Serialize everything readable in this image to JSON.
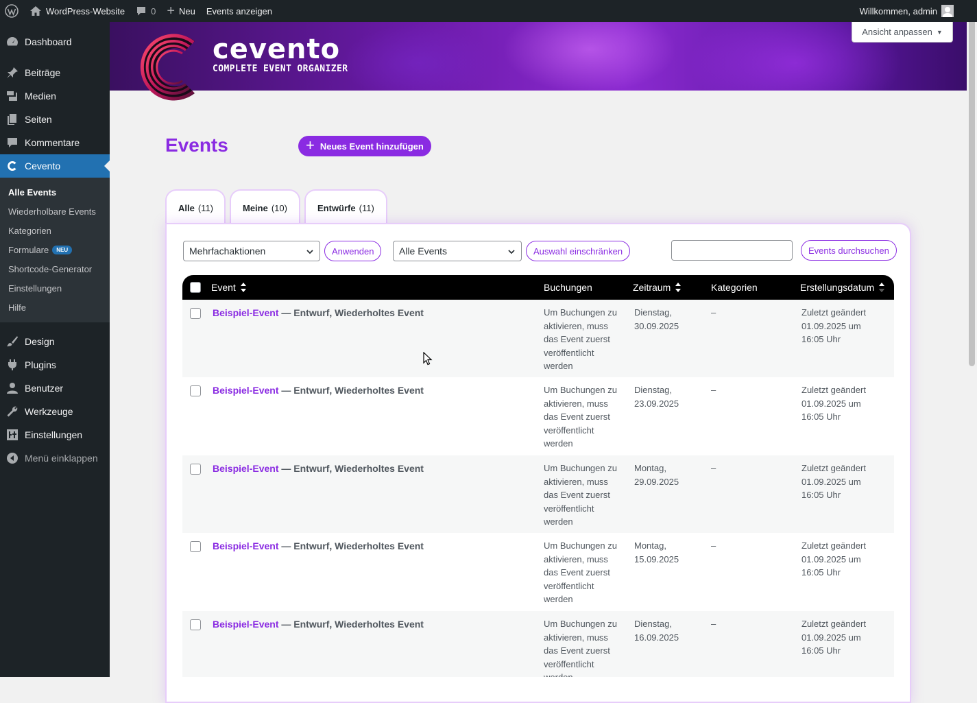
{
  "adminbar": {
    "site_name": "WordPress-Website",
    "comments_count": "0",
    "new_label": "Neu",
    "view_events": "Events anzeigen",
    "welcome": "Willkommen, admin"
  },
  "screen_options": "Ansicht anpassen",
  "brand": {
    "name": "cevento",
    "tagline": "COMPLETE EVENT ORGANIZER"
  },
  "sidebar": {
    "items": [
      {
        "label": "Dashboard",
        "icon": "dashboard-icon"
      },
      {
        "label": "Beiträge",
        "icon": "pin-icon"
      },
      {
        "label": "Medien",
        "icon": "media-icon"
      },
      {
        "label": "Seiten",
        "icon": "pages-icon"
      },
      {
        "label": "Kommentare",
        "icon": "comment-icon"
      },
      {
        "label": "Cevento",
        "icon": "cevento-icon"
      }
    ],
    "submenu": [
      {
        "label": "Alle Events"
      },
      {
        "label": "Wiederholbare Events"
      },
      {
        "label": "Kategorien"
      },
      {
        "label": "Formulare",
        "badge": "NEU"
      },
      {
        "label": "Shortcode-Generator"
      },
      {
        "label": "Einstellungen"
      },
      {
        "label": "Hilfe"
      }
    ],
    "items2": [
      {
        "label": "Design",
        "icon": "brush-icon"
      },
      {
        "label": "Plugins",
        "icon": "plugin-icon"
      },
      {
        "label": "Benutzer",
        "icon": "user-icon"
      },
      {
        "label": "Werkzeuge",
        "icon": "wrench-icon"
      },
      {
        "label": "Einstellungen",
        "icon": "settings-icon"
      },
      {
        "label": "Menü einklappen",
        "icon": "collapse-icon"
      }
    ]
  },
  "main": {
    "title": "Events",
    "add_new": "Neues Event hinzufügen",
    "tabs": [
      {
        "label": "Alle",
        "count": "(11)"
      },
      {
        "label": "Meine",
        "count": "(10)"
      },
      {
        "label": "Entwürfe",
        "count": "(11)"
      }
    ],
    "bulk_select": "Mehrfachaktionen",
    "apply": "Anwenden",
    "filter_select": "Alle Events",
    "filter_button": "Auswahl einschränken",
    "search_value": "",
    "search_button": "Events durchsuchen"
  },
  "table": {
    "columns": [
      "Event",
      "Buchungen",
      "Zeitraum",
      "Kategorien",
      "Erstellungsdatum"
    ],
    "rows": [
      {
        "title": "Beispiel-Event",
        "state": " — Entwurf, Wiederholtes Event",
        "bookings": "Um Buchungen zu aktivieren, muss das Event zuerst veröffentlicht werden",
        "day": "Dienstag,",
        "date": "30.09.2025",
        "category": "–",
        "created_1": "Zuletzt geändert",
        "created_2": "01.09.2025 um",
        "created_3": "16:05 Uhr"
      },
      {
        "title": "Beispiel-Event",
        "state": " — Entwurf, Wiederholtes Event",
        "bookings": "Um Buchungen zu aktivieren, muss das Event zuerst veröffentlicht werden",
        "day": "Dienstag,",
        "date": "23.09.2025",
        "category": "–",
        "created_1": "Zuletzt geändert",
        "created_2": "01.09.2025 um",
        "created_3": "16:05 Uhr"
      },
      {
        "title": "Beispiel-Event",
        "state": " — Entwurf, Wiederholtes Event",
        "bookings": "Um Buchungen zu aktivieren, muss das Event zuerst veröffentlicht werden",
        "day": "Montag,",
        "date": "29.09.2025",
        "category": "–",
        "created_1": "Zuletzt geändert",
        "created_2": "01.09.2025 um",
        "created_3": "16:05 Uhr"
      },
      {
        "title": "Beispiel-Event",
        "state": " — Entwurf, Wiederholtes Event",
        "bookings": "Um Buchungen zu aktivieren, muss das Event zuerst veröffentlicht werden",
        "day": "Montag,",
        "date": "15.09.2025",
        "category": "–",
        "created_1": "Zuletzt geändert",
        "created_2": "01.09.2025 um",
        "created_3": "16:05 Uhr"
      },
      {
        "title": "Beispiel-Event",
        "state": " — Entwurf, Wiederholtes Event",
        "bookings": "Um Buchungen zu aktivieren, muss das Event zuerst veröffentlicht werden",
        "day": "Dienstag,",
        "date": "16.09.2025",
        "category": "–",
        "created_1": "Zuletzt geändert",
        "created_2": "01.09.2025 um",
        "created_3": "16:05 Uhr"
      }
    ]
  },
  "colors": {
    "accent": "#8a2be2",
    "wp_dark": "#1d2327",
    "wp_blue": "#2271b1"
  }
}
